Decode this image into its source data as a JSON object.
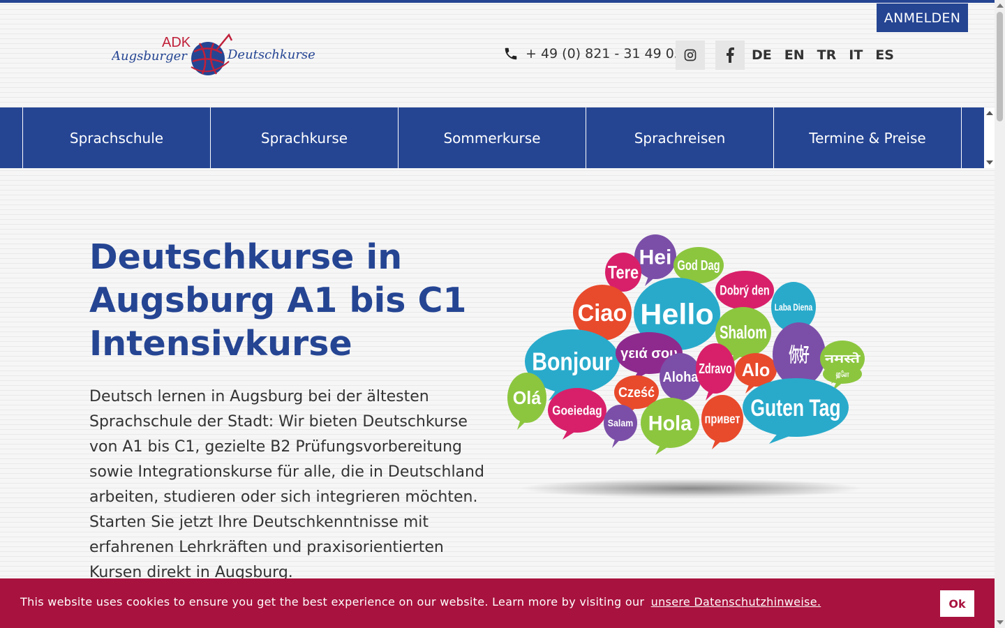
{
  "header": {
    "login_label": "ANMELDEN",
    "logo": {
      "abbr": "ADK",
      "left_word": "Augsburger",
      "right_word": "Deutschkurse"
    },
    "phone": "+ 49 (0) 821 - 31 49 05",
    "social": [
      "instagram-icon",
      "facebook-icon"
    ],
    "languages": [
      "DE",
      "EN",
      "TR",
      "IT",
      "ES"
    ]
  },
  "nav": {
    "items": [
      "Sprachschule",
      "Sprachkurse",
      "Sommerkurse",
      "Sprachreisen",
      "Termine & Preise"
    ]
  },
  "main": {
    "headline": "Deutschkurse in Augsburg A1 bis C1 Intensivkurse",
    "intro": "Deutsch lernen in Augsburg bei der ältesten Sprachschule der Stadt: Wir bieten Deutschkurse von A1 bis C1, gezielte B2 Prüfungsvorbereitung sowie Integrationskurse für alle, die in Deutschland arbeiten, studieren oder sich integrieren möchten. Starten Sie jetzt Ihre Deutschkenntnisse mit erfahrenen Lehrkräften und praxisorientierten Kursen direkt in Augsburg."
  },
  "cloud": {
    "bubbles": [
      "Hei",
      "Tere",
      "God Dag",
      "Dobrý den",
      "Ciao",
      "Hello",
      "Laba Diena",
      "Shalom",
      "Bonjour",
      "γειά σου",
      "Aloha",
      "Zdravo",
      "Alo",
      "你好",
      "नमस्ते",
      "ஹலோ",
      "Olá",
      "Goeiedag",
      "Cześć",
      "Salam",
      "Hola",
      "привет",
      "Guten Tag"
    ]
  },
  "cookie": {
    "text": "This website uses cookies to ensure you get the best experience on our website. Learn more by visiting our",
    "link": "unsere Datenschutzhinweise.",
    "ok": "Ok"
  },
  "colors": {
    "primary": "#254593",
    "cookie_bg": "#a8123e",
    "logo_red": "#c0203a"
  }
}
